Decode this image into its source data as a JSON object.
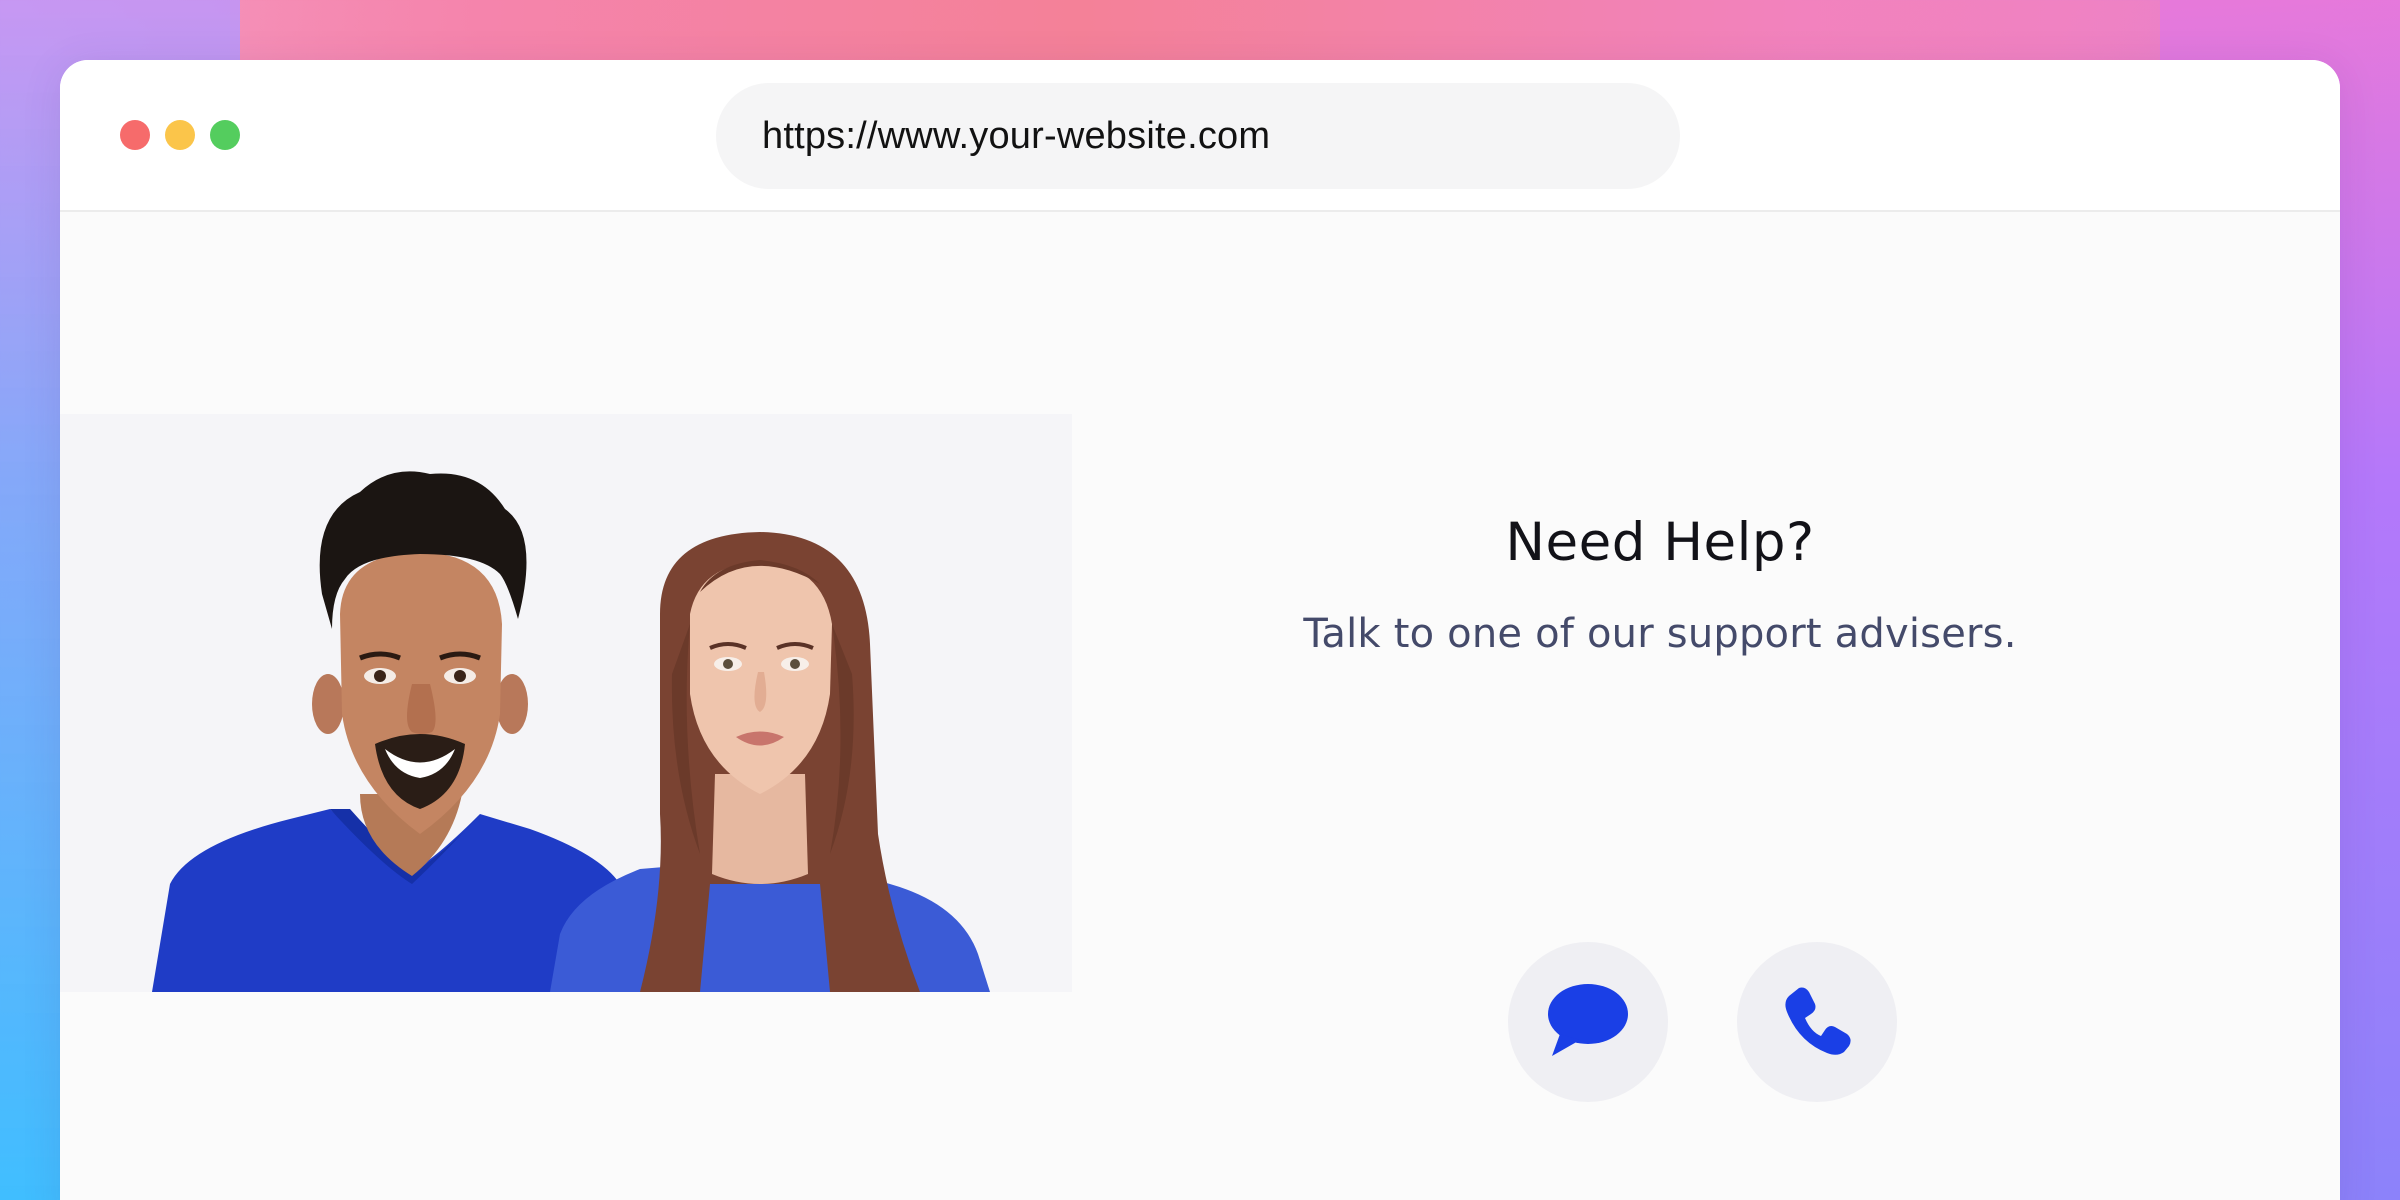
{
  "browser": {
    "url": "https://www.your-website.com",
    "traffic_lights": [
      "close",
      "minimize",
      "zoom"
    ]
  },
  "page": {
    "hero_image_alt": "two support advisers",
    "help": {
      "title": "Need Help?",
      "subtitle": "Talk to one of our support advisers."
    },
    "actions": [
      {
        "icon": "chat-bubble-icon"
      },
      {
        "icon": "phone-icon"
      }
    ]
  },
  "colors": {
    "accent": "#1a3fe6",
    "button_bg": "#efeff3",
    "subtitle": "#444a6a",
    "shirt": "#2140c8"
  }
}
